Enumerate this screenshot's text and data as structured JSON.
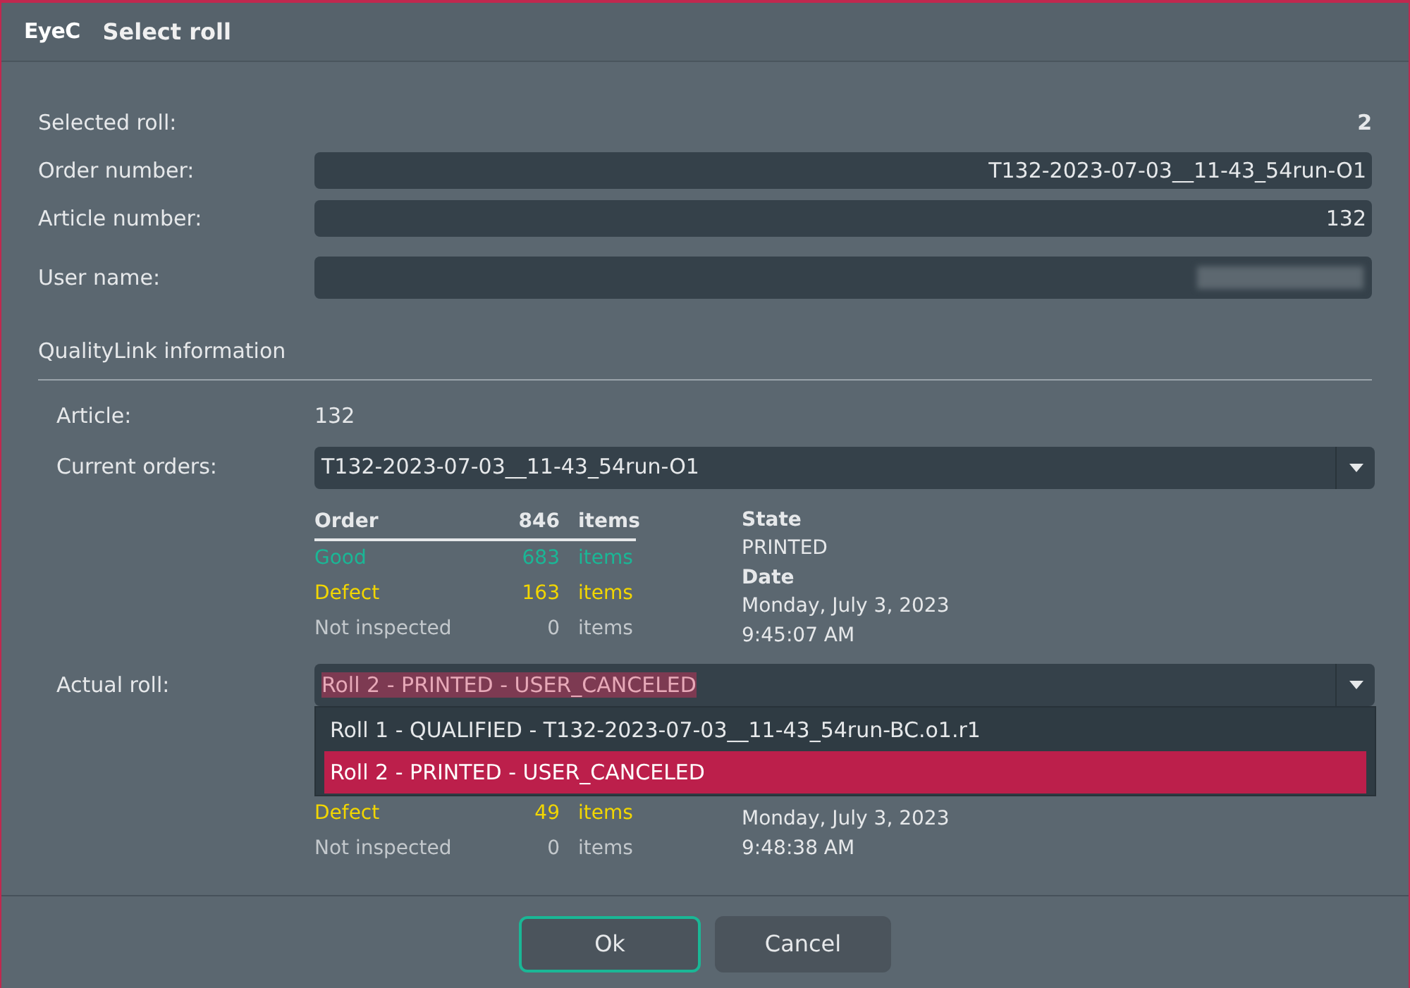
{
  "window": {
    "title": "Select roll",
    "logo": "EyeC"
  },
  "fields": [
    {
      "label": "Selected roll:",
      "value": "2",
      "kind": "plain"
    },
    {
      "label": "Order number:",
      "value": "T132-2023-07-03__11-43_54run-O1",
      "kind": "input"
    },
    {
      "label": "Article number:",
      "value": "132",
      "kind": "input"
    },
    {
      "label": "User name:",
      "kind": "redacted"
    }
  ],
  "section": {
    "title": "QualityLink information"
  },
  "article": {
    "label": "Article:",
    "value": "132"
  },
  "current_orders": {
    "label": "Current orders:",
    "value": "T132-2023-07-03__11-43_54run-O1"
  },
  "order_table": {
    "header": {
      "label": "Order",
      "count": "846",
      "unit": "items"
    },
    "rows": [
      {
        "kind": "good",
        "label": "Good",
        "count": "683",
        "unit": "items"
      },
      {
        "kind": "defect",
        "label": "Defect",
        "count": "163",
        "unit": "items"
      },
      {
        "kind": "none",
        "label": "Not inspected",
        "count": "0",
        "unit": "items"
      }
    ],
    "info": [
      {
        "kind": "heading",
        "text": "State"
      },
      {
        "kind": "value",
        "text": "PRINTED"
      },
      {
        "kind": "heading",
        "text": "Date"
      },
      {
        "kind": "value",
        "text": "Monday, July 3, 2023"
      },
      {
        "kind": "value",
        "text": "9:45:07 AM"
      }
    ]
  },
  "actual_roll": {
    "label": "Actual roll:",
    "value": "Roll 2 - PRINTED -  USER_CANCELED",
    "expanded": true,
    "options": [
      {
        "text": "Roll 1 - QUALIFIED -  T132-2023-07-03__11-43_54run-BC.o1.r1",
        "selected": false
      },
      {
        "text": "Roll 2 - PRINTED -  USER_CANCELED",
        "selected": true
      }
    ]
  },
  "roll_table": {
    "rows": [
      {
        "kind": "defect",
        "label": "Defect",
        "count": "49",
        "unit": "items"
      },
      {
        "kind": "none",
        "label": "Not inspected",
        "count": "0",
        "unit": "items"
      }
    ],
    "info": [
      {
        "text": "Monday, July 3, 2023"
      },
      {
        "text": "9:48:38 AM"
      }
    ]
  },
  "buttons": [
    {
      "label": "Ok",
      "default": true
    },
    {
      "label": "Cancel",
      "default": false
    }
  ]
}
